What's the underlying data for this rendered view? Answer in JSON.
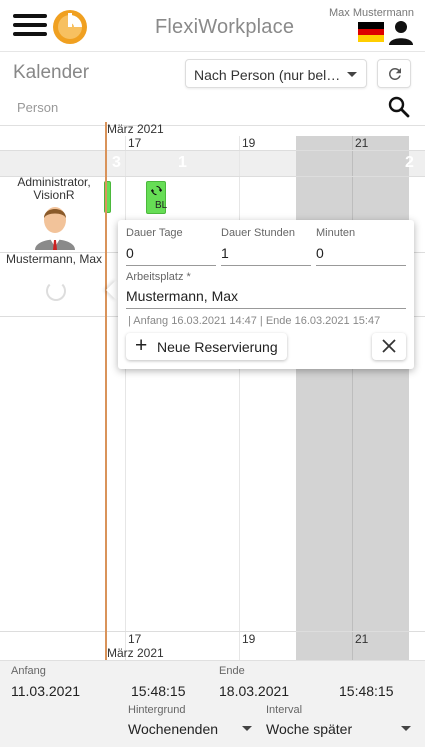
{
  "header": {
    "app_title": "FlexiWorkplace",
    "user_name": "Max Mustermann",
    "flag_colors": [
      "#000000",
      "#dd0000",
      "#ffce00"
    ]
  },
  "toolbar": {
    "page_title": "Kalender",
    "view_select": "Nach Person (nur bel…",
    "person_label": "Person"
  },
  "calendar": {
    "month_top": "März 2021",
    "month_bottom": "März 2021",
    "days_top": [
      "17",
      "19",
      "21"
    ],
    "days_bottom": [
      "17",
      "19",
      "21"
    ],
    "week_numbers": [
      "3",
      "1",
      "2"
    ],
    "persons": [
      {
        "name": "Administrator, VisionR"
      },
      {
        "name": "Mustermann, Max"
      }
    ],
    "event_label": "BL"
  },
  "popup": {
    "dauer_tage_label": "Dauer Tage",
    "dauer_tage_value": "0",
    "dauer_stunden_label": "Dauer Stunden",
    "dauer_stunden_value": "1",
    "minuten_label": "Minuten",
    "minuten_value": "0",
    "arbeitsplatz_label": "Arbeitsplatz *",
    "arbeitsplatz_value": "Mustermann, Max",
    "range_info": "| Anfang 16.03.2021 14:47 | Ende 16.03.2021 15:47",
    "new_reservation_label": "Neue Reservierung"
  },
  "footer": {
    "anfang_label": "Anfang",
    "anfang_date": "11.03.2021",
    "anfang_time": "15:48:15",
    "ende_label": "Ende",
    "ende_date": "18.03.2021",
    "ende_time": "15:48:15",
    "hintergrund_label": "Hintergrund",
    "hintergrund_value": "Wochenenden",
    "interval_label": "Interval",
    "interval_value": "Woche später"
  }
}
